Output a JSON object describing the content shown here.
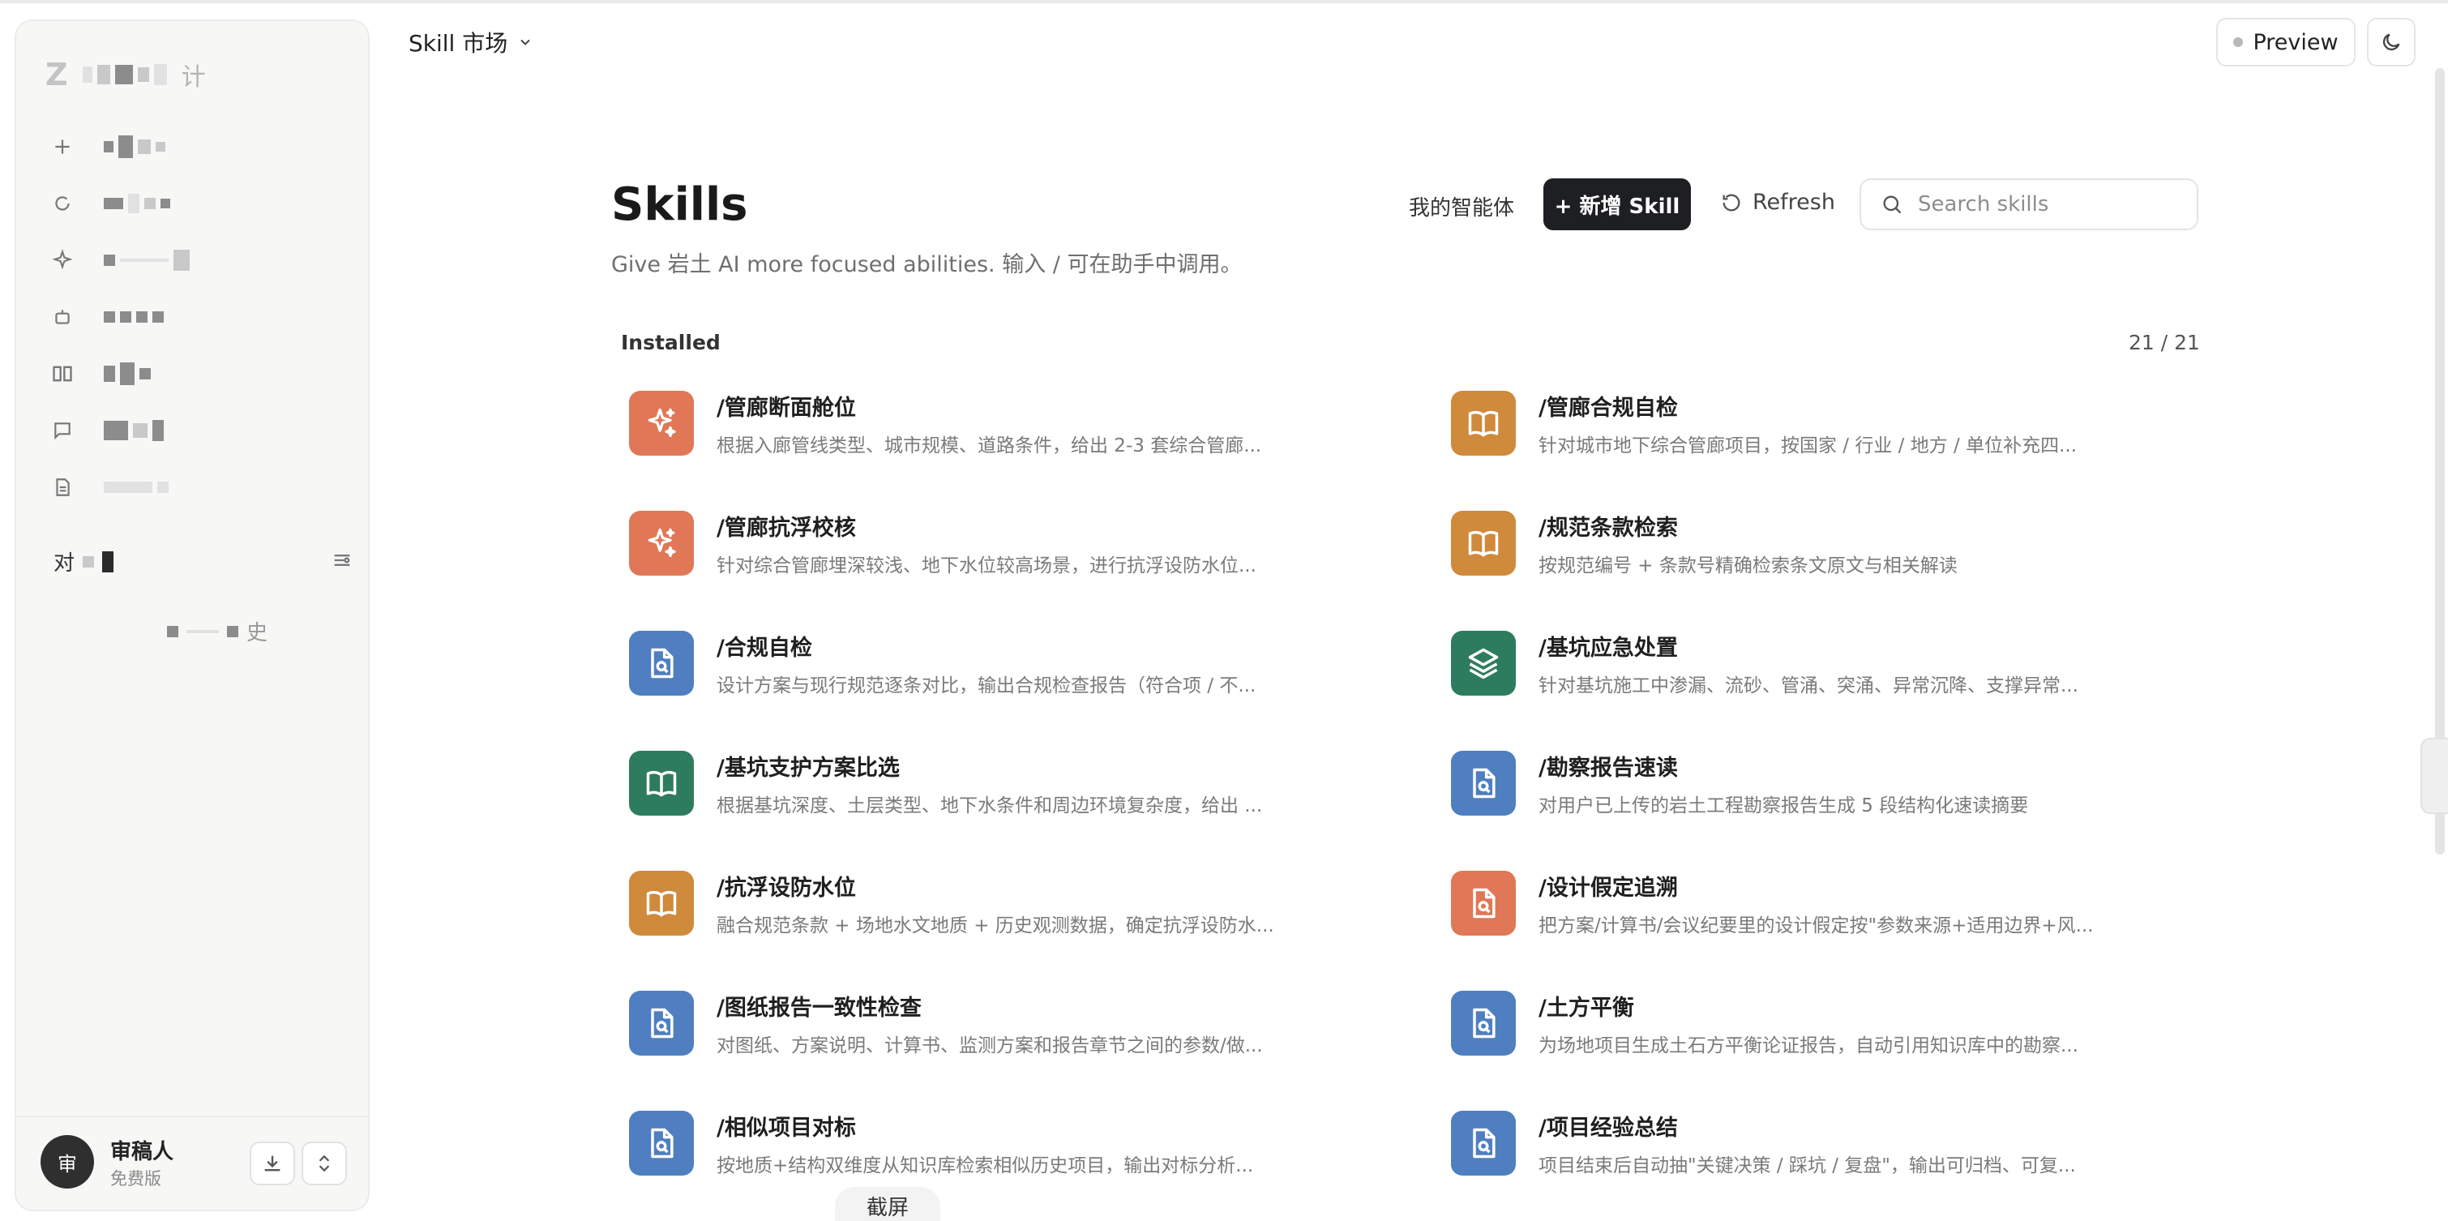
{
  "sidebar": {
    "logo": "Z",
    "title_tail": "计",
    "section_label": "对",
    "history_tail": "史",
    "user": {
      "avatar": "审",
      "name": "审稿人",
      "plan": "免费版"
    }
  },
  "topbar": {
    "market_label": "Skill 市场",
    "preview_label": "Preview"
  },
  "main": {
    "title": "Skills",
    "subtitle": "Give 岩土 AI more focused abilities. 输入 / 可在助手中调用。",
    "agents_link": "我的智能体",
    "add_button": "+ 新增 Skill",
    "refresh_button": "Refresh",
    "search_placeholder": "Search skills",
    "installed_label": "Installed",
    "count": "21 / 21"
  },
  "skills": [
    {
      "name": "/管廊断面舱位",
      "desc": "根据入廊管线类型、城市规模、道路条件，给出 2-3 套综合管廊...",
      "icon": "sparkle-icon",
      "color": "#e07756"
    },
    {
      "name": "/管廊合规自检",
      "desc": "针对城市地下综合管廊项目，按国家 / 行业 / 地方 / 单位补充四...",
      "icon": "book-icon",
      "color": "#cf8a3c"
    },
    {
      "name": "/管廊抗浮校核",
      "desc": "针对综合管廊埋深较浅、地下水位较高场景，进行抗浮设防水位...",
      "icon": "sparkle-icon",
      "color": "#e07756"
    },
    {
      "name": "/规范条款检索",
      "desc": "按规范编号 + 条款号精确检索条文原文与相关解读",
      "icon": "book-icon",
      "color": "#cf8a3c"
    },
    {
      "name": "/合规自检",
      "desc": "设计方案与现行规范逐条对比，输出合规检查报告（符合项 / 不...",
      "icon": "doc-search-icon",
      "color": "#4f7fc0"
    },
    {
      "name": "/基坑应急处置",
      "desc": "针对基坑施工中渗漏、流砂、管涌、突涌、异常沉降、支撑异常...",
      "icon": "layers-icon",
      "color": "#2e7c5e"
    },
    {
      "name": "/基坑支护方案比选",
      "desc": "根据基坑深度、土层类型、地下水条件和周边环境复杂度，给出 ...",
      "icon": "book-icon",
      "color": "#2e7c5e"
    },
    {
      "name": "/勘察报告速读",
      "desc": "对用户已上传的岩土工程勘察报告生成 5 段结构化速读摘要",
      "icon": "doc-search-icon",
      "color": "#4f7fc0"
    },
    {
      "name": "/抗浮设防水位",
      "desc": "融合规范条款 + 场地水文地质 + 历史观测数据，确定抗浮设防水...",
      "icon": "book-icon",
      "color": "#cf8a3c"
    },
    {
      "name": "/设计假定追溯",
      "desc": "把方案/计算书/会议纪要里的设计假定按\"参数来源+适用边界+风...",
      "icon": "doc-search-icon",
      "color": "#e07756"
    },
    {
      "name": "/图纸报告一致性检查",
      "desc": "对图纸、方案说明、计算书、监测方案和报告章节之间的参数/做...",
      "icon": "doc-search-icon",
      "color": "#4f7fc0"
    },
    {
      "name": "/土方平衡",
      "desc": "为场地项目生成土石方平衡论证报告，自动引用知识库中的勘察...",
      "icon": "doc-search-icon",
      "color": "#4f7fc0"
    },
    {
      "name": "/相似项目对标",
      "desc": "按地质+结构双维度从知识库检索相似历史项目，输出对标分析...",
      "icon": "doc-search-icon",
      "color": "#4f7fc0"
    },
    {
      "name": "/项目经验总结",
      "desc": "项目结束后自动抽\"关键决策 / 踩坑 / 复盘\"，输出可归档、可复...",
      "icon": "doc-search-icon",
      "color": "#4f7fc0"
    }
  ],
  "toast": "截屏"
}
